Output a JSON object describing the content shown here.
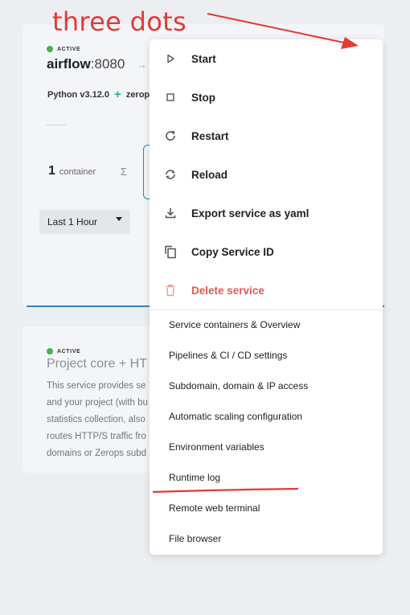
{
  "annotation": {
    "text": "three dots"
  },
  "service": {
    "status": "ACTIVE",
    "name": "airflow",
    "port": ":8080",
    "runtime": "Python v3.12.0",
    "extra": "zerops",
    "container_count": "1",
    "container_label": "container",
    "time_range": "Last 1 Hour"
  },
  "core": {
    "status": "ACTIVE",
    "title": "Project core + HT",
    "description_lines": [
      "This service provides se",
      "and your project (with bu",
      "statistics collection, also",
      "routes HTTP/S traffic fro",
      "domains or Zerops subd"
    ]
  },
  "menu": {
    "actions": [
      {
        "label": "Start",
        "icon": "play-icon"
      },
      {
        "label": "Stop",
        "icon": "stop-icon"
      },
      {
        "label": "Restart",
        "icon": "restart-icon"
      },
      {
        "label": "Reload",
        "icon": "reload-icon"
      },
      {
        "label": "Export service as yaml",
        "icon": "download-icon"
      },
      {
        "label": "Copy Service ID",
        "icon": "copy-icon"
      },
      {
        "label": "Delete service",
        "icon": "trash-icon"
      }
    ],
    "sections": [
      "Service containers & Overview",
      "Pipelines & CI / CD settings",
      "Subdomain, domain & IP access",
      "Automatic scaling configuration",
      "Environment variables",
      "Runtime log",
      "Remote web terminal",
      "File browser"
    ]
  },
  "colors": {
    "accent": "#2e86c1",
    "danger": "#e05a5a",
    "annotation": "#e53935",
    "active": "#4caf50"
  }
}
